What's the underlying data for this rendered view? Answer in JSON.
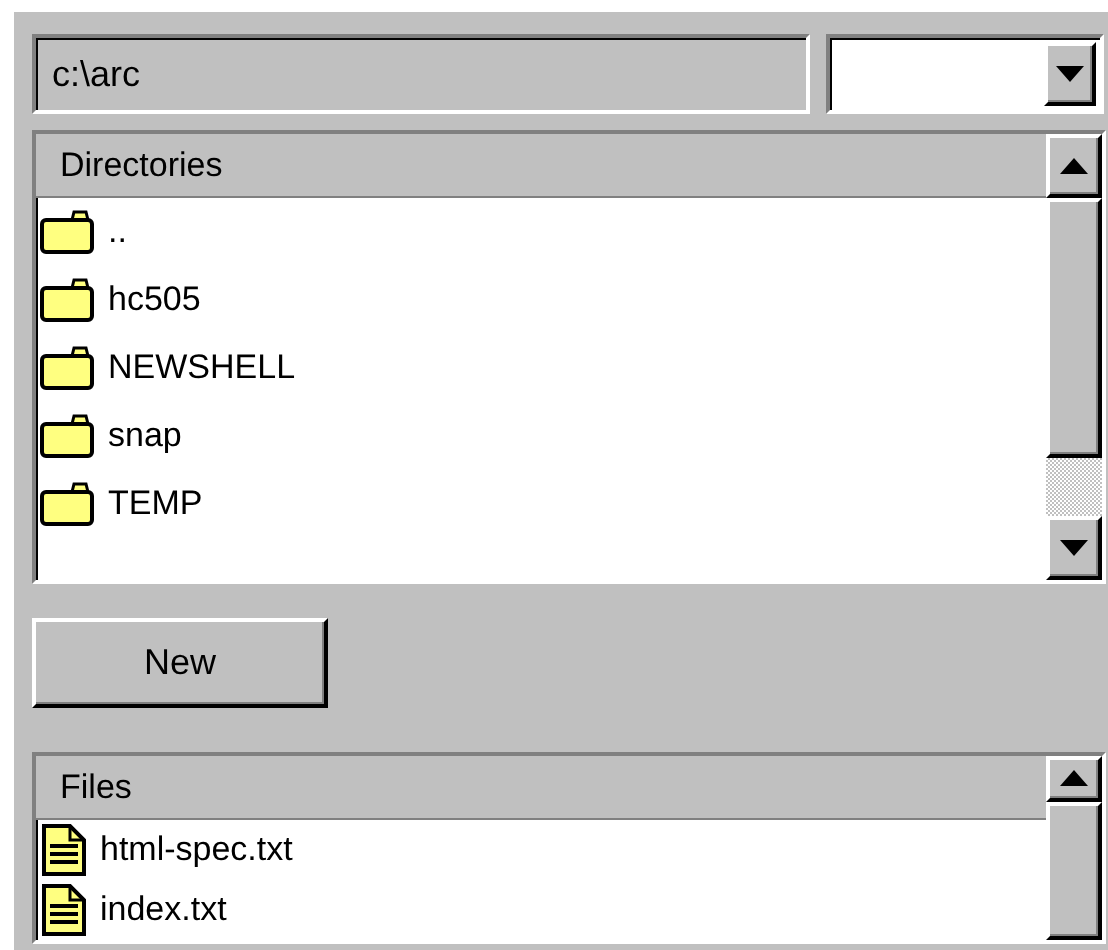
{
  "path_field": {
    "value": "c:\\arc"
  },
  "directories": {
    "header": "Directories",
    "items": [
      {
        "name": ".."
      },
      {
        "name": "hc505"
      },
      {
        "name": "NEWSHELL"
      },
      {
        "name": "snap"
      },
      {
        "name": "TEMP"
      }
    ]
  },
  "new_button": {
    "label": "New"
  },
  "files": {
    "header": "Files",
    "items": [
      {
        "name": "html-spec.txt"
      },
      {
        "name": "index.txt"
      }
    ]
  }
}
